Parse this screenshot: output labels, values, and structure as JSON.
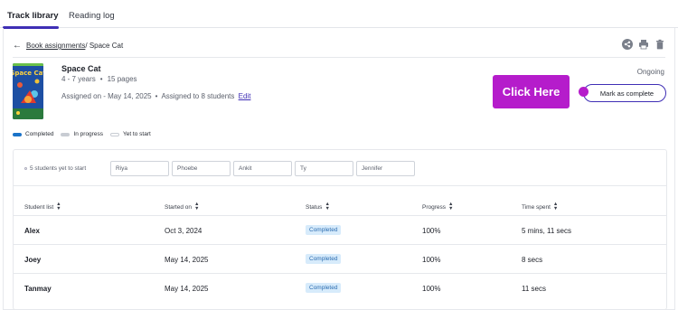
{
  "tabs": [
    {
      "label": "Track library",
      "active": true
    },
    {
      "label": "Reading log",
      "active": false
    }
  ],
  "breadcrumb": {
    "back_icon": "arrow-left-icon",
    "link": "Book assignments",
    "current": "/ Space Cat"
  },
  "toolbar": {
    "icons": [
      "share-icon",
      "print-icon",
      "trash-icon"
    ]
  },
  "book": {
    "title": "Space Cat",
    "cover_text": "Space Cat",
    "ages": "4 - 7 years",
    "pages": "15 pages",
    "assigned_on": "Assigned on - May 14, 2025",
    "assigned_to": "Assigned to 8 students",
    "edit_label": "Edit",
    "status": "Ongoing"
  },
  "callout": {
    "text": "Click Here",
    "color": "#b51ccb"
  },
  "actions": {
    "mark_complete": "Mark as complete"
  },
  "legend": [
    {
      "label": "Completed",
      "color": "#1a73c8"
    },
    {
      "label": "In progress",
      "color": "#c8ccd3"
    },
    {
      "label": "Yet to start",
      "color": "#ffffff"
    }
  ],
  "yet_to_start": {
    "label": "5 students yet to start",
    "names": [
      "Riya",
      "Phoebe",
      "Ankit",
      "Ty",
      "Jennifer"
    ]
  },
  "table": {
    "headers": [
      "Student list",
      "Started on",
      "Status",
      "Progress",
      "Time spent"
    ],
    "rows": [
      {
        "student": "Alex",
        "started": "Oct 3, 2024",
        "status": "Completed",
        "progress": "100%",
        "time": "5 mins, 11 secs"
      },
      {
        "student": "Joey",
        "started": "May 14, 2025",
        "status": "Completed",
        "progress": "100%",
        "time": "8 secs"
      },
      {
        "student": "Tanmay",
        "started": "May 14, 2025",
        "status": "Completed",
        "progress": "100%",
        "time": "11 secs"
      }
    ]
  },
  "colors": {
    "accent": "#3f2fb5",
    "badge_bg": "#d7ebfb",
    "badge_text": "#2b6cb0"
  }
}
